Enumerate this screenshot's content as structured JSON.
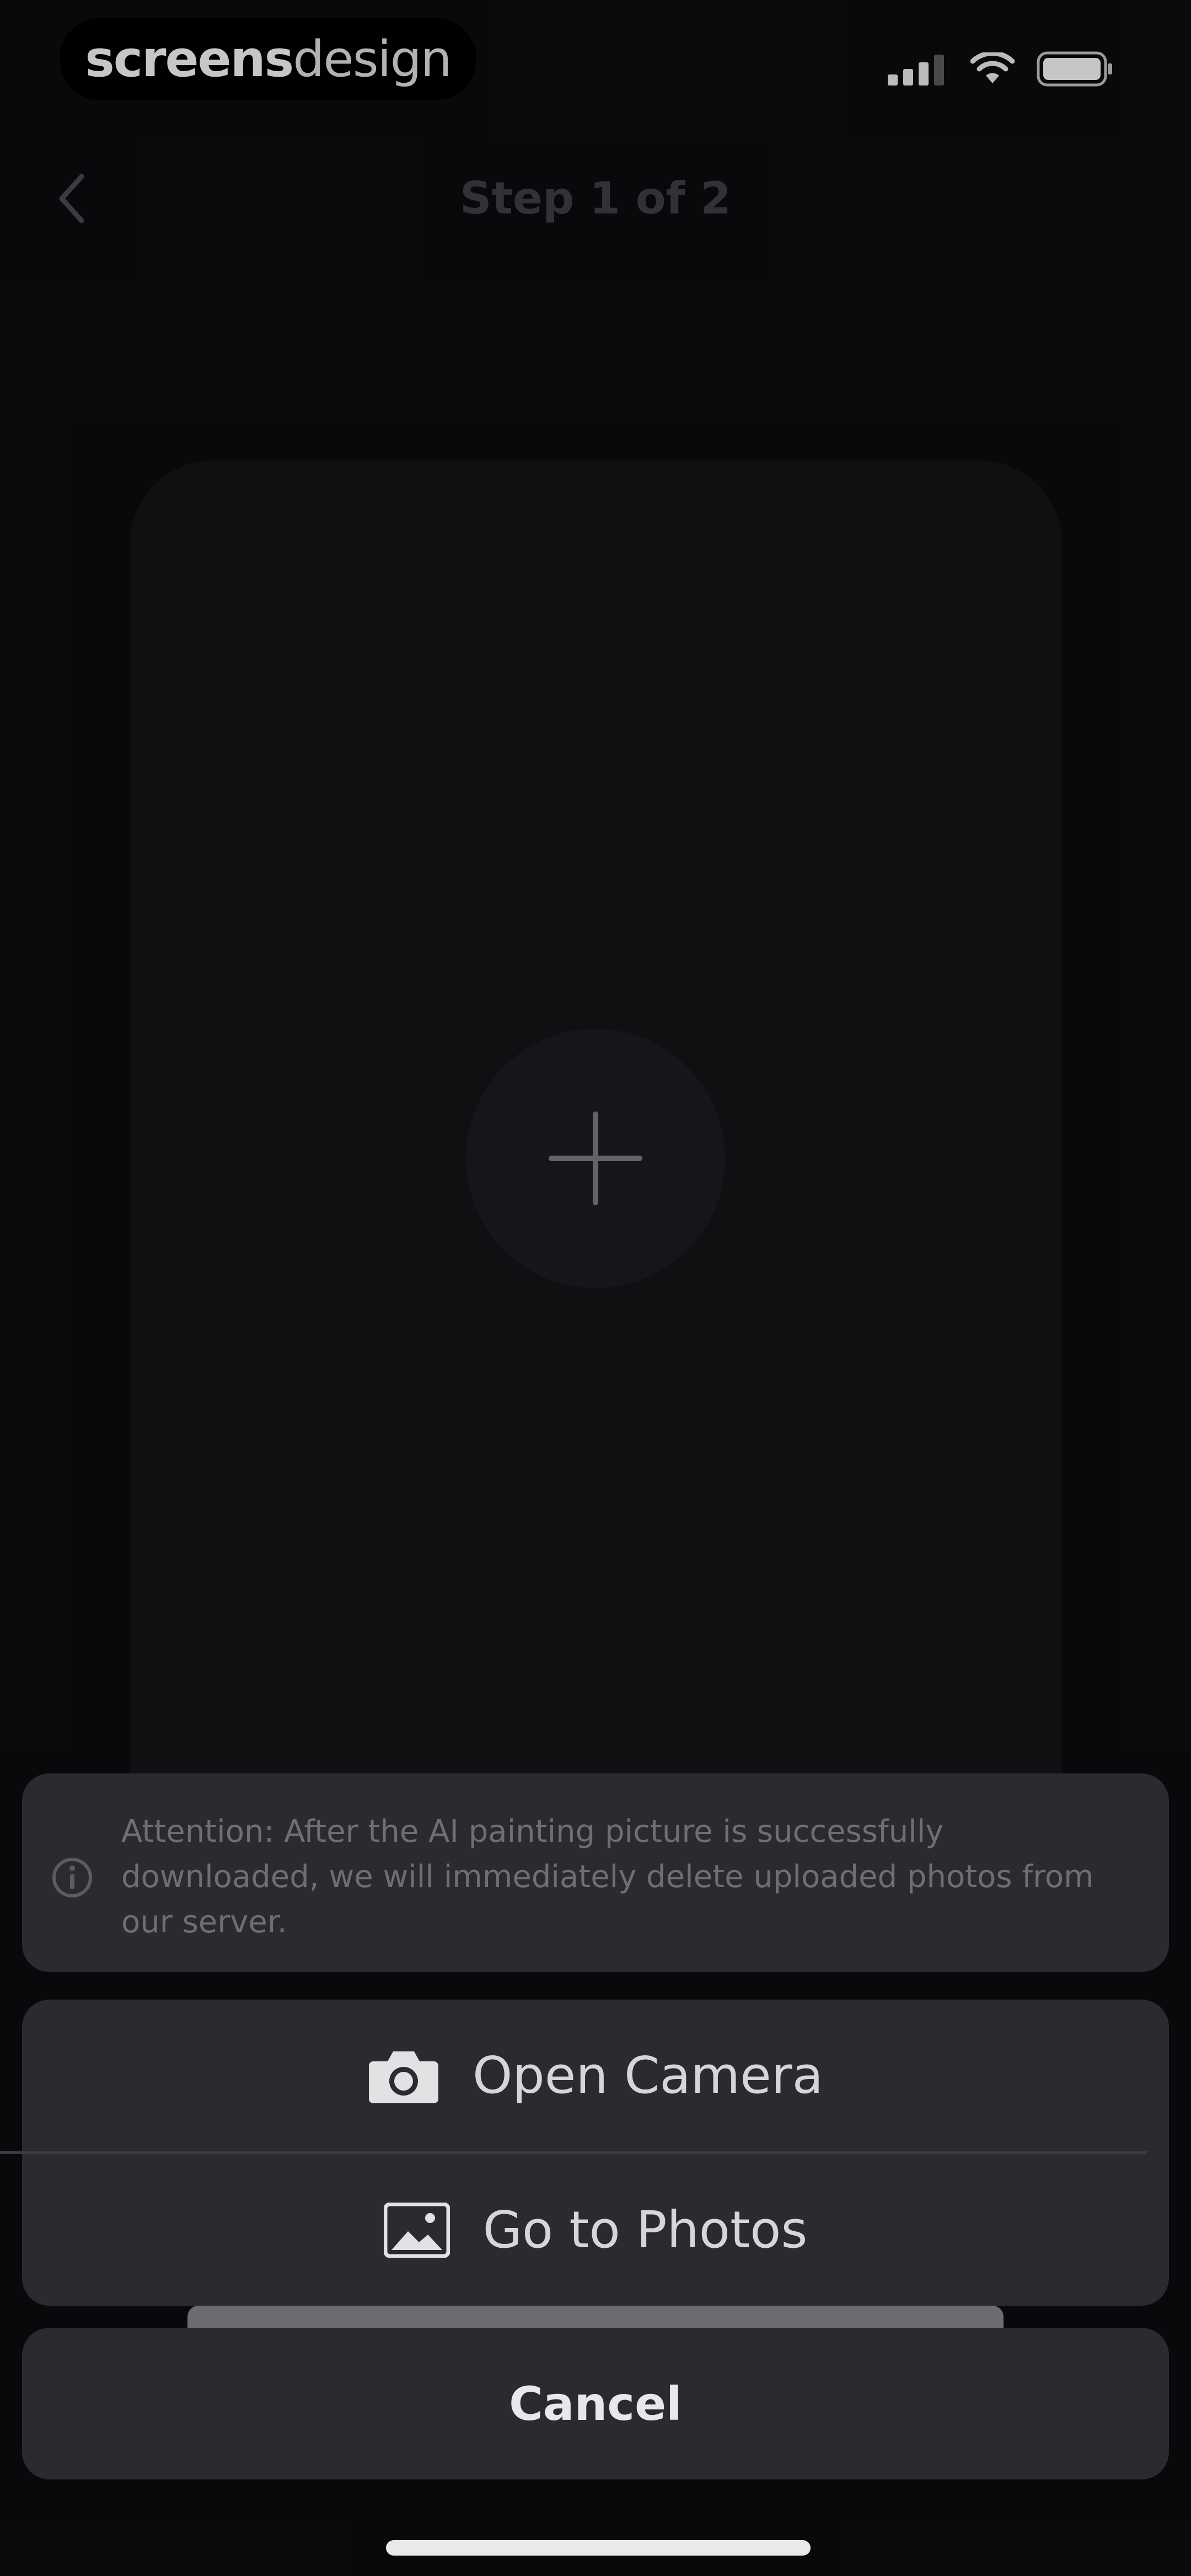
{
  "status_bar": {
    "brand_bold": "screens",
    "brand_light": "design",
    "icons": [
      "cellular-signal-icon",
      "wifi-icon",
      "battery-icon"
    ]
  },
  "nav": {
    "back_icon": "chevron-left-icon",
    "title": "Step 1 of 2"
  },
  "upload": {
    "add_icon": "plus-icon"
  },
  "sheet": {
    "notice": {
      "icon": "info-circle-icon",
      "text": "Attention: After the AI painting picture is successfully downloaded, we will immediately delete uploaded photos from our server."
    },
    "options": [
      {
        "icon": "camera-icon",
        "label": "Open Camera"
      },
      {
        "icon": "photos-icon",
        "label": "Go to Photos"
      }
    ],
    "cancel_label": "Cancel"
  },
  "colors": {
    "background": "#0c0b0e",
    "card": "#141317",
    "sheet": "#2b2a2f",
    "muted_text": "#6f6e74"
  }
}
